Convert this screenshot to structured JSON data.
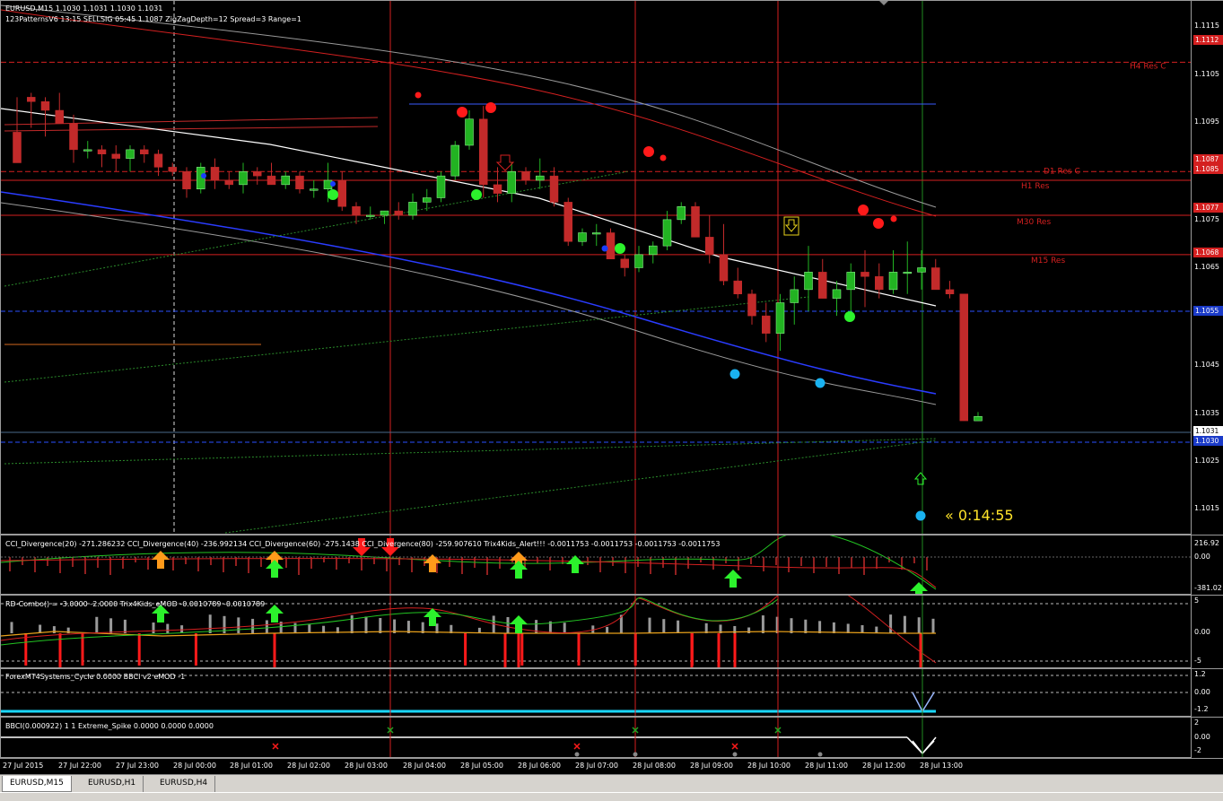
{
  "main": {
    "title": "EURUSD,M15  1.1030 1.1031 1.1030 1.1031",
    "subtitle": "123PatternsV6  13:15  SELLSIG  05:45  1.1087  ZigZagDepth=12  Spread=3  Range=1",
    "levels": [
      "H4 Res C",
      "D1 Res C",
      "H1 Res",
      "M30 Res",
      "M15 Res"
    ],
    "countdown": "« 0:14:55",
    "price_axis": [
      "1.1115",
      "1.1105",
      "1.1095",
      "1.1075",
      "1.1065",
      "1.1045",
      "1.1035",
      "1.1025",
      "1.1015"
    ],
    "price_tags": [
      "1.1112",
      "1.1087",
      "1.1085",
      "1.1077",
      "1.1068",
      "1.1055",
      "1.1031",
      "1.1030"
    ],
    "tag_label_ms": "MS"
  },
  "cci": {
    "label": "CCI_Divergence(20) -271.286232  CCI_Divergence(40) -236.992134  CCI_Divergence(60) -275.1438  CCI_Divergence(80) -259.907610  Trix4Kids_Alert!!! -0.0011753 -0.0011753 -0.0011753 -0.0011753",
    "axis": [
      "216.92",
      "0.00",
      "-381.02"
    ]
  },
  "rd": {
    "label": "RD-Combo() = -3.0000 -2.0000  Trix4Kids_eMOD -0.0010789 -0.0010789",
    "axis": [
      "5",
      "0.00",
      "-5"
    ]
  },
  "cycle": {
    "label": "ForexMT4Systems_Cycle 0.0000  BBCI v2 eMOD -1",
    "axis": [
      "1.2",
      "0.00",
      "-1.2"
    ]
  },
  "bbci": {
    "label": "BBCI(0.000922) 1 1  Extreme_Spike 0.0000 0.0000 0.0000",
    "axis": [
      "2",
      "0.00",
      "-2"
    ]
  },
  "time_axis": [
    "27 Jul 2015",
    "27 Jul 22:00",
    "27 Jul 23:00",
    "28 Jul 00:00",
    "28 Jul 01:00",
    "28 Jul 02:00",
    "28 Jul 03:00",
    "28 Jul 04:00",
    "28 Jul 05:00",
    "28 Jul 06:00",
    "28 Jul 07:00",
    "28 Jul 08:00",
    "28 Jul 09:00",
    "28 Jul 10:00",
    "28 Jul 11:00",
    "28 Jul 12:00",
    "28 Jul 13:00"
  ],
  "tabs": [
    "EURUSD,M15",
    "EURUSD,H1",
    "EURUSD,H4"
  ],
  "colors": {
    "bull": "#22b322",
    "bear": "#c22a2a",
    "level": "#d42020",
    "bg": "#000000"
  },
  "chart_data": {
    "type": "candlestick",
    "candles": [
      [
        1.1096,
        1.1104,
        1.1096,
        1.1089
      ],
      [
        1.1104,
        1.1105,
        1.1097,
        1.1103
      ],
      [
        1.1103,
        1.1104,
        1.1095,
        1.1101
      ],
      [
        1.1101,
        1.1105,
        1.1098,
        1.1098
      ],
      [
        1.1098,
        1.11,
        1.1089,
        1.1092
      ],
      [
        1.1092,
        1.1094,
        1.109,
        1.1092
      ],
      [
        1.1092,
        1.1093,
        1.1088,
        1.1091
      ],
      [
        1.1091,
        1.1093,
        1.1087,
        1.109
      ],
      [
        1.109,
        1.1093,
        1.1087,
        1.1092
      ],
      [
        1.1092,
        1.1093,
        1.1089,
        1.1091
      ],
      [
        1.1091,
        1.1092,
        1.1086,
        1.1088
      ],
      [
        1.1088,
        1.1089,
        1.1086,
        1.1087
      ],
      [
        1.1087,
        1.1088,
        1.1081,
        1.1083
      ],
      [
        1.1083,
        1.1089,
        1.1082,
        1.1088
      ],
      [
        1.1088,
        1.109,
        1.1083,
        1.1085
      ],
      [
        1.1085,
        1.1087,
        1.1083,
        1.1084
      ],
      [
        1.1084,
        1.1089,
        1.1082,
        1.1087
      ],
      [
        1.1087,
        1.1088,
        1.1084,
        1.1086
      ],
      [
        1.1086,
        1.1089,
        1.1084,
        1.1084
      ],
      [
        1.1084,
        1.1087,
        1.1083,
        1.1086
      ],
      [
        1.1086,
        1.1087,
        1.1082,
        1.1083
      ],
      [
        1.1083,
        1.1085,
        1.1081,
        1.1083
      ],
      [
        1.1083,
        1.1089,
        1.108,
        1.1085
      ],
      [
        1.1085,
        1.1087,
        1.1078,
        1.1079
      ],
      [
        1.1079,
        1.108,
        1.1075,
        1.1077
      ],
      [
        1.1077,
        1.1079,
        1.1076,
        1.1077
      ],
      [
        1.1077,
        1.1078,
        1.1075,
        1.1078
      ],
      [
        1.1078,
        1.108,
        1.1076,
        1.1077
      ],
      [
        1.1077,
        1.1082,
        1.1076,
        1.108
      ],
      [
        1.108,
        1.1083,
        1.1078,
        1.1081
      ],
      [
        1.1081,
        1.1087,
        1.108,
        1.1086
      ],
      [
        1.1086,
        1.1094,
        1.1085,
        1.1093
      ],
      [
        1.1093,
        1.1101,
        1.1092,
        1.1099
      ],
      [
        1.1099,
        1.1102,
        1.1081,
        1.1084
      ],
      [
        1.1084,
        1.1088,
        1.108,
        1.1082
      ],
      [
        1.1082,
        1.1089,
        1.108,
        1.1087
      ],
      [
        1.1087,
        1.1088,
        1.1084,
        1.1085
      ],
      [
        1.1085,
        1.109,
        1.1083,
        1.1086
      ],
      [
        1.1086,
        1.1088,
        1.1079,
        1.108
      ],
      [
        1.108,
        1.1081,
        1.107,
        1.1071
      ],
      [
        1.1071,
        1.1074,
        1.107,
        1.1073
      ],
      [
        1.1073,
        1.1075,
        1.107,
        1.1073
      ],
      [
        1.1073,
        1.1074,
        1.1067,
        1.1067
      ],
      [
        1.1067,
        1.1068,
        1.1063,
        1.1065
      ],
      [
        1.1065,
        1.107,
        1.1064,
        1.1068
      ],
      [
        1.1068,
        1.1071,
        1.1066,
        1.107
      ],
      [
        1.107,
        1.1078,
        1.1069,
        1.1076
      ],
      [
        1.1076,
        1.108,
        1.1075,
        1.1079
      ],
      [
        1.1079,
        1.108,
        1.1072,
        1.1072
      ],
      [
        1.1072,
        1.1077,
        1.1066,
        1.1068
      ],
      [
        1.1068,
        1.1075,
        1.1061,
        1.1062
      ],
      [
        1.1062,
        1.1065,
        1.1058,
        1.1059
      ],
      [
        1.1059,
        1.106,
        1.1052,
        1.1054
      ],
      [
        1.1054,
        1.1057,
        1.1048,
        1.105
      ],
      [
        1.105,
        1.1059,
        1.1046,
        1.1057
      ],
      [
        1.1057,
        1.1063,
        1.1052,
        1.106
      ],
      [
        1.106,
        1.107,
        1.1055,
        1.1064
      ],
      [
        1.1064,
        1.1067,
        1.1058,
        1.1058
      ],
      [
        1.1058,
        1.1062,
        1.1054,
        1.106
      ],
      [
        1.106,
        1.1066,
        1.1053,
        1.1064
      ],
      [
        1.1064,
        1.1069,
        1.1056,
        1.1063
      ],
      [
        1.1063,
        1.1066,
        1.1058,
        1.106
      ],
      [
        1.106,
        1.1069,
        1.1059,
        1.1064
      ],
      [
        1.1064,
        1.1071,
        1.1059,
        1.1064
      ],
      [
        1.1064,
        1.1069,
        1.106,
        1.1065
      ],
      [
        1.1065,
        1.1067,
        1.106,
        1.106
      ],
      [
        1.106,
        1.1062,
        1.1058,
        1.1059
      ],
      [
        1.1059,
        1.1059,
        1.103,
        1.103
      ],
      [
        1.103,
        1.1032,
        1.103,
        1.1031
      ]
    ],
    "ylim": [
      1.1005,
      1.1125
    ],
    "xlabels": [
      "27 Jul 2015",
      "27 Jul 22:00",
      "27 Jul 23:00",
      "28 Jul 00:00",
      "28 Jul 01:00",
      "28 Jul 02:00",
      "28 Jul 03:00",
      "28 Jul 04:00",
      "28 Jul 05:00",
      "28 Jul 06:00",
      "28 Jul 07:00",
      "28 Jul 08:00",
      "28 Jul 09:00",
      "28 Jul 10:00",
      "28 Jul 11:00",
      "28 Jul 12:00",
      "28 Jul 13:00"
    ],
    "resistance": [
      {
        "name": "H4 Res C",
        "value": 1.1112
      },
      {
        "name": "D1 Res C",
        "value": 1.1087
      },
      {
        "name": "H1 Res",
        "value": 1.1085
      },
      {
        "name": "M30 Res",
        "value": 1.1077
      },
      {
        "name": "M15 Res",
        "value": 1.1068
      }
    ]
  }
}
